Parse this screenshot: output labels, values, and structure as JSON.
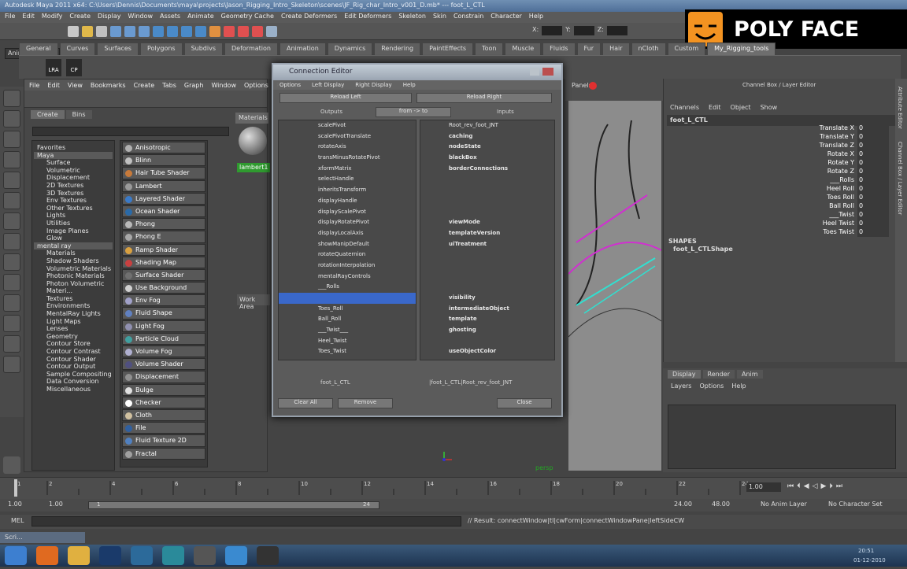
{
  "window_title": "Autodesk Maya 2011 x64: C:\\Users\\Dennis\\Documents\\maya\\projects\\Jason_Rigging_Intro_Skeleton\\scenes\\JF_Rig_char_Intro_v001_D.mb*   ---   foot_L_CTL",
  "main_menu": [
    "File",
    "Edit",
    "Modify",
    "Create",
    "Display",
    "Window",
    "Assets",
    "Animate",
    "Geometry Cache",
    "Create Deformers",
    "Edit Deformers",
    "Skeleton",
    "Skin",
    "Constrain",
    "Character",
    "Help"
  ],
  "mode_selector": "Animation",
  "status_fields": [
    "X:",
    "Y:",
    "Z:"
  ],
  "shelf_tabs": [
    "General",
    "Curves",
    "Surfaces",
    "Polygons",
    "Subdivs",
    "Deformation",
    "Animation",
    "Dynamics",
    "Rendering",
    "PaintEffects",
    "Toon",
    "Muscle",
    "Fluids",
    "Fur",
    "Hair",
    "nCloth",
    "Custom",
    "My_Rigging_tools"
  ],
  "shelf_active": "My_Rigging_tools",
  "shelf_icon_labels": [
    "LRA",
    "CP"
  ],
  "logo_text": "POLY FACE",
  "hypershade": {
    "menu": [
      "File",
      "Edit",
      "View",
      "Bookmarks",
      "Create",
      "Tabs",
      "Graph",
      "Window",
      "Options",
      "Panels"
    ],
    "tabs": [
      "Create",
      "Bins"
    ],
    "materials_tab": "Materials",
    "material_name": "lambert1",
    "work_area": "Work Area",
    "categories": [
      "Favorites",
      "Maya",
      "Surface",
      "Volumetric",
      "Displacement",
      "2D Textures",
      "3D Textures",
      "Env Textures",
      "Other Textures",
      "Lights",
      "Utilities",
      "Image Planes",
      "Glow",
      "mental ray",
      "Materials",
      "Shadow Shaders",
      "Volumetric Materials",
      "Photonic Materials",
      "Photon Volumetric Materi...",
      "Textures",
      "Environments",
      "MentalRay Lights",
      "Light Maps",
      "Lenses",
      "Geometry",
      "Contour Store",
      "Contour Contrast",
      "Contour Shader",
      "Contour Output",
      "Sample Compositing",
      "Data Conversion",
      "Miscellaneous"
    ],
    "nodes": [
      {
        "label": "Anisotropic",
        "color": "#b0b0b0"
      },
      {
        "label": "Blinn",
        "color": "#c0c0c0"
      },
      {
        "label": "Hair Tube Shader",
        "color": "#c87a3a"
      },
      {
        "label": "Lambert",
        "color": "#9a9a9a"
      },
      {
        "label": "Layered Shader",
        "color": "#3a7ac8"
      },
      {
        "label": "Ocean Shader",
        "color": "#2a6aa8"
      },
      {
        "label": "Phong",
        "color": "#b8b8b8"
      },
      {
        "label": "Phong E",
        "color": "#a8a8a8"
      },
      {
        "label": "Ramp Shader",
        "color": "#d8a040"
      },
      {
        "label": "Shading Map",
        "color": "#c84040"
      },
      {
        "label": "Surface Shader",
        "color": "#707070"
      },
      {
        "label": "Use Background",
        "color": "#d0d0d0"
      },
      {
        "label": "Env Fog",
        "color": "#a0a0c8"
      },
      {
        "label": "Fluid Shape",
        "color": "#6080c0"
      },
      {
        "label": "Light Fog",
        "color": "#9090b0"
      },
      {
        "label": "Particle Cloud",
        "color": "#40a0a0"
      },
      {
        "label": "Volume Fog",
        "color": "#b0b0d0"
      },
      {
        "label": "Volume Shader",
        "color": "#505080"
      },
      {
        "label": "Displacement",
        "color": "#909090"
      },
      {
        "label": "Bulge",
        "color": "#e0e0e0"
      },
      {
        "label": "Checker",
        "color": "#ffffff"
      },
      {
        "label": "Cloth",
        "color": "#d0c0a0"
      },
      {
        "label": "File",
        "color": "#3060a0"
      },
      {
        "label": "Fluid Texture 2D",
        "color": "#5080c0"
      },
      {
        "label": "Fractal",
        "color": "#a0a0a0"
      }
    ]
  },
  "connection_editor": {
    "title": "Connection Editor",
    "menu": [
      "Options",
      "Left Display",
      "Right Display",
      "Help"
    ],
    "reload_left": "Reload Left",
    "reload_right": "Reload Right",
    "outputs": "Outputs",
    "direction": "from -> to",
    "inputs": "Inputs",
    "left_items": [
      "scalePivot",
      "scalePivotTranslate",
      "rotateAxis",
      "transMinusRotatePivot",
      "xformMatrix",
      "selectHandle",
      "inheritsTransform",
      "displayHandle",
      "displayScalePivot",
      "displayRotatePivot",
      "displayLocalAxis",
      "showManipDefault",
      "rotateQuaternion",
      "rotationInterpolation",
      "mentalRayControls",
      "___Rolls",
      "",
      "Toes_Roll",
      "Ball_Roll",
      "___Twist___",
      "Heel_Twist",
      "Toes_Twist"
    ],
    "selected_left_index": 16,
    "right_root": "Root_rev_foot_JNT",
    "right_items": [
      {
        "label": "caching",
        "dim": false
      },
      {
        "label": "nodeState",
        "dim": false
      },
      {
        "label": "blackBox",
        "dim": false
      },
      {
        "label": "borderConnections",
        "dim": false
      },
      {
        "label": "",
        "dim": true
      },
      {
        "label": "",
        "dim": true
      },
      {
        "label": "",
        "dim": true
      },
      {
        "label": "",
        "dim": true
      },
      {
        "label": "viewMode",
        "dim": false
      },
      {
        "label": "templateVersion",
        "dim": false
      },
      {
        "label": "uiTreatment",
        "dim": false
      },
      {
        "label": "",
        "dim": true
      },
      {
        "label": "",
        "dim": true
      },
      {
        "label": "",
        "dim": true
      },
      {
        "label": "",
        "dim": true
      },
      {
        "label": "visibility",
        "dim": false
      },
      {
        "label": "intermediateObject",
        "dim": false
      },
      {
        "label": "template",
        "dim": false
      },
      {
        "label": "ghosting",
        "dim": false
      },
      {
        "label": "",
        "dim": true
      },
      {
        "label": "useObjectColor",
        "dim": false
      }
    ],
    "left_node": "foot_L_CTL",
    "right_node": "|foot_L_CTL|Root_rev_foot_JNT",
    "clear_all": "Clear All",
    "remove": "Remove",
    "close": "Close"
  },
  "viewport": {
    "panel_menu": "Panels",
    "camera": "persp"
  },
  "channel_box": {
    "title": "Channel Box / Layer Editor",
    "menu": [
      "Channels",
      "Edit",
      "Object",
      "Show"
    ],
    "object": "foot_L_CTL",
    "attributes": [
      {
        "name": "Translate X",
        "value": "0"
      },
      {
        "name": "Translate Y",
        "value": "0"
      },
      {
        "name": "Translate Z",
        "value": "0"
      },
      {
        "name": "Rotate X",
        "value": "0"
      },
      {
        "name": "Rotate Y",
        "value": "0"
      },
      {
        "name": "Rotate Z",
        "value": "0"
      },
      {
        "name": "___Rolls",
        "value": "0"
      },
      {
        "name": "Heel Roll",
        "value": "0"
      },
      {
        "name": "Toes Roll",
        "value": "0"
      },
      {
        "name": "Ball Roll",
        "value": "0"
      },
      {
        "name": "___Twist",
        "value": "0"
      },
      {
        "name": "Heel Twist",
        "value": "0"
      },
      {
        "name": "Toes Twist",
        "value": "0"
      }
    ],
    "shapes_label": "SHAPES",
    "shape_name": "foot_L_CTLShape",
    "layer_tabs": [
      "Display",
      "Render",
      "Anim"
    ],
    "layer_menu": [
      "Layers",
      "Options",
      "Help"
    ],
    "side_tabs": [
      "Attribute Editor",
      "Channel Box / Layer Editor"
    ]
  },
  "timeline": {
    "ticks": [
      "1",
      "2",
      "4",
      "6",
      "8",
      "10",
      "12",
      "14",
      "16",
      "18",
      "20",
      "22",
      "24"
    ],
    "current_frame": "1.00",
    "range_start": "1.00",
    "playback_start": "1.00",
    "range_slider_start": "1",
    "range_slider_end": "24",
    "playback_end": "24.00",
    "range_end": "48.00",
    "anim_layer": "No Anim Layer",
    "character_set": "No Character Set"
  },
  "command_line": {
    "label": "MEL",
    "result": "// Result: connectWindow|tl|cwForm|connectWindowPane|leftSideCW"
  },
  "script_window": "Scri...",
  "taskbar_apps": [
    {
      "name": "windows-start",
      "color": "#3d7fd0"
    },
    {
      "name": "firefox",
      "color": "#e06a20"
    },
    {
      "name": "folder",
      "color": "#e0b040"
    },
    {
      "name": "photoshop",
      "color": "#1a3a6a"
    },
    {
      "name": "maya",
      "color": "#2c6a9a"
    },
    {
      "name": "app-5",
      "color": "#2a8a9a"
    },
    {
      "name": "app-6",
      "color": "#555"
    },
    {
      "name": "app-7",
      "color": "#3a8ad0"
    },
    {
      "name": "app-8",
      "color": "#333"
    }
  ],
  "clock": {
    "time": "20:51",
    "date": "01-12-2010"
  }
}
